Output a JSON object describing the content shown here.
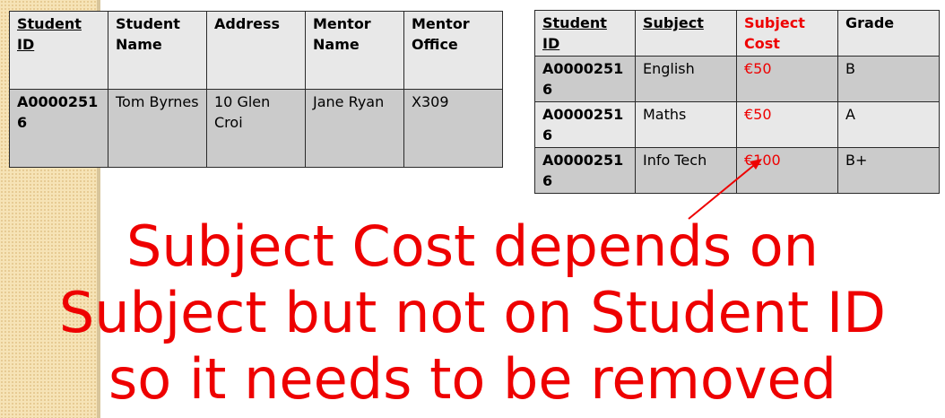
{
  "student_table": {
    "headers": [
      "Student ID",
      "Student Name",
      "Address",
      "Mentor Name",
      "Mentor Office"
    ],
    "row": [
      "A00002516",
      "Tom Byrnes",
      "10 Glen Croi",
      "Jane Ryan",
      "X309"
    ]
  },
  "subject_table": {
    "headers": [
      "Student ID",
      "Subject",
      "Subject Cost",
      "Grade"
    ],
    "rows": [
      [
        "A00002516",
        "English",
        "€50",
        "B"
      ],
      [
        "A00002516",
        "Maths",
        "€50",
        "A"
      ],
      [
        "A00002516",
        "Info Tech",
        "€100",
        "B+"
      ]
    ]
  },
  "caption": {
    "line1": "Subject Cost depends on",
    "line2": "Subject but not on Student ID",
    "line3": "so it needs to be removed"
  },
  "colors": {
    "accent_red": "#ee0000",
    "row_light": "#e8e8e8",
    "row_dark": "#cbcbcb",
    "side_strip": "#f6e3b6"
  }
}
